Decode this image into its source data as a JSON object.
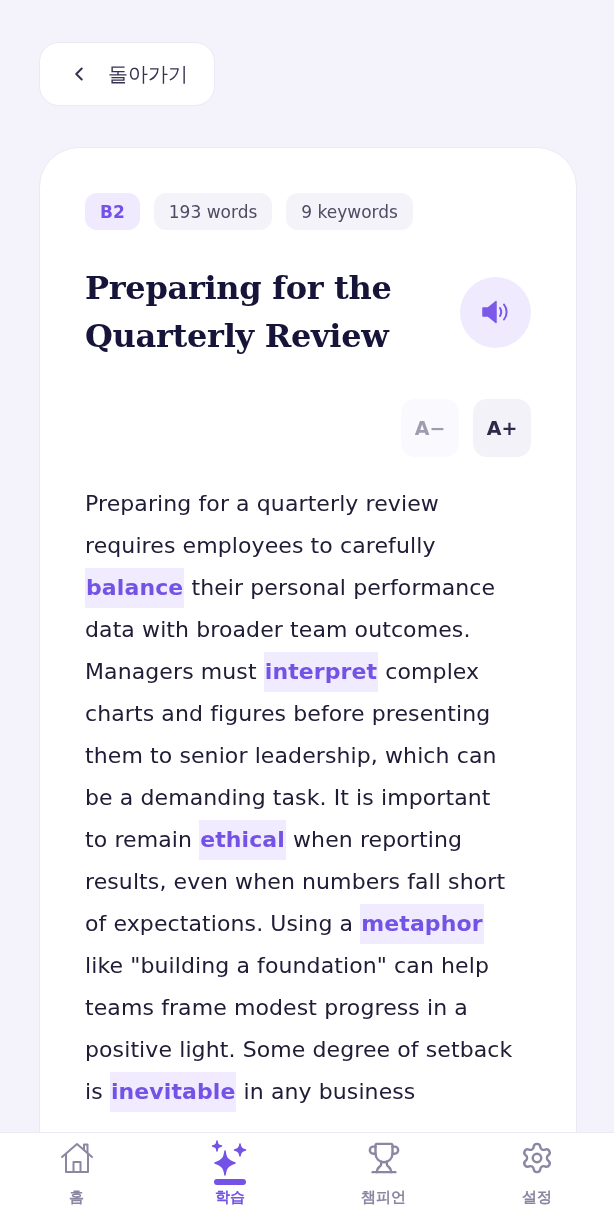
{
  "back_button": {
    "label": "돌아가기"
  },
  "article": {
    "tags": [
      {
        "label": "B2",
        "kind": "level"
      },
      {
        "label": "193 words",
        "kind": "count"
      },
      {
        "label": "9 keywords",
        "kind": "count"
      }
    ],
    "title": "Preparing for the Quarterly Review",
    "font_size_buttons": [
      {
        "label": "A−",
        "disabled": true
      },
      {
        "label": "A+",
        "disabled": false
      }
    ],
    "body": [
      {
        "kind": "text",
        "text": "Preparing for a quarterly review requires employees to carefully "
      },
      {
        "kind": "keyword",
        "text": "balance"
      },
      {
        "kind": "text",
        "text": " their personal performance data with broader team outcomes. Managers must "
      },
      {
        "kind": "keyword",
        "text": "interpret"
      },
      {
        "kind": "text",
        "text": " complex charts and figures before presenting them to senior leadership, which can be a demanding task. It is important to remain "
      },
      {
        "kind": "keyword",
        "text": "ethical"
      },
      {
        "kind": "text",
        "text": " when reporting results, even when numbers fall short of expectations. Using a "
      },
      {
        "kind": "keyword",
        "text": "metaphor"
      },
      {
        "kind": "text",
        "text": " like \"building a foundation\" can help teams frame modest progress in a positive light. Some degree of setback is "
      },
      {
        "kind": "keyword",
        "text": "inevitable"
      },
      {
        "kind": "text",
        "text": " in any business"
      }
    ]
  },
  "nav": {
    "items": [
      {
        "label": "홈",
        "selected": false
      },
      {
        "label": "학습",
        "selected": true
      },
      {
        "label": "챔피언",
        "selected": false
      },
      {
        "label": "설정",
        "selected": false
      }
    ]
  }
}
